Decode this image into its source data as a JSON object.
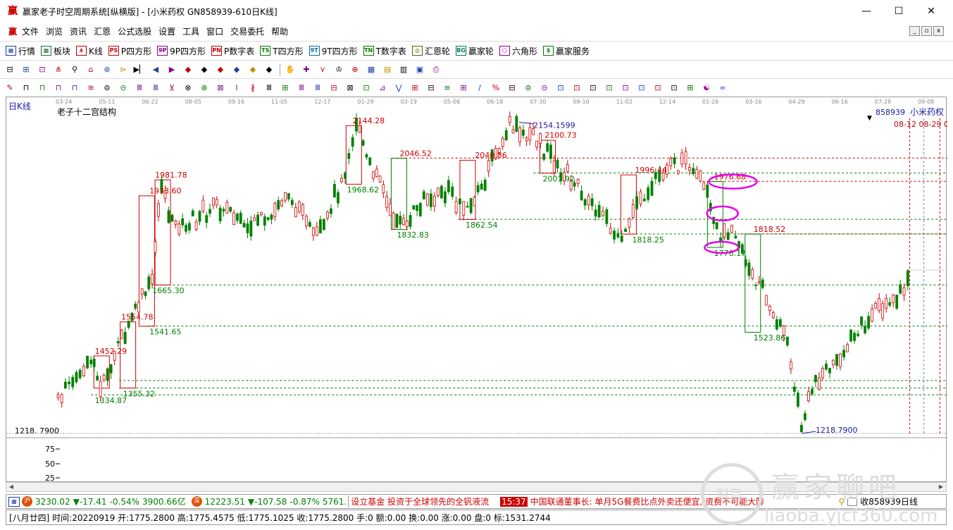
{
  "window": {
    "title": "赢家老子时空周期系统[纵横版] - [小米药权  GN858939-610日K线]",
    "logo": "赢",
    "minimize": "—",
    "maximize": "☐",
    "close": "✕"
  },
  "menu": {
    "logo": "赢",
    "items": [
      "文件",
      "浏览",
      "资讯",
      "汇恩",
      "公式选股",
      "设置",
      "工具",
      "窗口",
      "交易委托",
      "帮助"
    ]
  },
  "toolbar1": [
    {
      "label": "行情",
      "icon": "grid-icon",
      "glyph": "▦",
      "color": "#1f3fa8"
    },
    {
      "label": "板块",
      "icon": "blocks-icon",
      "glyph": "▩",
      "color": "#1f6f3f"
    },
    {
      "label": "K线",
      "icon": "candle-icon",
      "glyph": "⋔",
      "color": "#c00000"
    },
    {
      "label": "P四方形",
      "icon": "ps-icon",
      "glyph": "PS",
      "color": "#c00000"
    },
    {
      "label": "9P四方形",
      "icon": "9p-icon",
      "glyph": "9P",
      "color": "#8a008a"
    },
    {
      "label": "P数字表",
      "icon": "pn-icon",
      "glyph": "PN",
      "color": "#c00000"
    },
    {
      "label": "T四方形",
      "icon": "ts-icon",
      "glyph": "TS",
      "color": "#007a00"
    },
    {
      "label": "9T四方形",
      "icon": "9t-icon",
      "glyph": "9T",
      "color": "#00709a"
    },
    {
      "label": "T数字表",
      "icon": "tn-icon",
      "glyph": "TN",
      "color": "#007a00"
    },
    {
      "label": "汇恩轮",
      "icon": "wheel-icon",
      "glyph": "◎",
      "color": "#4a6a00"
    },
    {
      "label": "赢家轮",
      "icon": "bg-wheel-icon",
      "glyph": "BG",
      "color": "#007a5a"
    },
    {
      "label": "六角形",
      "icon": "hexagon-icon",
      "glyph": "⬡",
      "color": "#8a008a"
    },
    {
      "label": "赢家服务",
      "icon": "dollar-icon",
      "glyph": "$",
      "color": "#007a00"
    }
  ],
  "chart": {
    "period_label": "日K线",
    "indicator_label": "老子十二宫结构",
    "code": "858939",
    "name": "小米药权",
    "date_marks": "08-12  08-29  09-09",
    "axis_dates": [
      "03-24",
      "05-11",
      "06-22",
      "08-05",
      "09-16",
      "11-05",
      "12-17",
      "01-29",
      "03-19",
      "05-06",
      "06-18",
      "07-30",
      "09-10",
      "11-02",
      "12-14",
      "01-26",
      "03-16",
      "04-29",
      "06-16",
      "07-28",
      "09-08"
    ],
    "y_min_label": "1218. 7900",
    "volume_ticks": [
      "75",
      "50",
      "25"
    ]
  },
  "chart_data": {
    "type": "candlestick",
    "annotations_red": [
      {
        "label": "2144.28",
        "x": 0.368,
        "y": 2144.28
      },
      {
        "label": "2046.52",
        "x": 0.418,
        "y": 2046.52
      },
      {
        "label": "2040.86",
        "x": 0.498,
        "y": 2040.86
      },
      {
        "label": "2100.73",
        "x": 0.572,
        "y": 2100.73
      },
      {
        "label": "1996.44",
        "x": 0.668,
        "y": 1996.44
      },
      {
        "label": "1976.68",
        "x": 0.752,
        "y": 1976.68
      },
      {
        "label": "1818.52",
        "x": 0.794,
        "y": 1818.52
      },
      {
        "label": "1981.78",
        "x": 0.158,
        "y": 1981.78
      },
      {
        "label": "1933.60",
        "x": 0.152,
        "y": 1933.6
      },
      {
        "label": "1554.78",
        "x": 0.122,
        "y": 1554.78
      },
      {
        "label": "1452.29",
        "x": 0.094,
        "y": 1452.29
      }
    ],
    "annotations_green": [
      {
        "label": "1968.62",
        "x": 0.362,
        "y": 1968.62
      },
      {
        "label": "1832.83",
        "x": 0.415,
        "y": 1832.83
      },
      {
        "label": "1862.54",
        "x": 0.488,
        "y": 1862.54
      },
      {
        "label": "2001.92",
        "x": 0.57,
        "y": 2001.92
      },
      {
        "label": "1818.25",
        "x": 0.665,
        "y": 1818.25
      },
      {
        "label": "1778.17",
        "x": 0.752,
        "y": 1778.17
      },
      {
        "label": "1523.86",
        "x": 0.794,
        "y": 1523.86
      },
      {
        "label": "1665.30",
        "x": 0.155,
        "y": 1665.3
      },
      {
        "label": "1541.65",
        "x": 0.152,
        "y": 1541.65
      },
      {
        "label": "1355.32",
        "x": 0.124,
        "y": 1355.32
      },
      {
        "label": "1334.87",
        "x": 0.094,
        "y": 1334.87
      }
    ],
    "annotations_blue": [
      {
        "label": "2154.1599",
        "x": 0.56,
        "y": 2154.16
      },
      {
        "label": "1218.7900",
        "x": 0.86,
        "y": 1218.79
      }
    ],
    "ylim": [
      1218.79,
      2170
    ]
  },
  "ticker": {
    "idx1_value": "3230.02",
    "idx1_change": "▼-17.41",
    "idx1_pct": "-0.54%",
    "idx1_amt": "3900.66亿",
    "idx2_value": "12223.51",
    "idx2_change": "▼-107.58",
    "idx2_pct": "-0.87%",
    "idx2_amt": "5761.",
    "news1": "设立基金 投资于全球领先的全钒液流",
    "time": "15:37",
    "news2": "中国联通董事长: 单月5G餐费比点外卖还便宜, 资费不可能大降",
    "right": "收858939日线"
  },
  "status": {
    "text": "[八月廿四] 时间:20220919 开:1775.2800 高:1775.4575 低:1775.1025 收:1775.2800 手:0 额:0.00 换:0.00 涨:0.00 盘:0 标:1531.2744"
  },
  "watermark": {
    "big": "赢家聊吧",
    "small": "liaoba.yjcf360.com",
    "seal": "财富"
  },
  "colors": {
    "up": "#d00000",
    "down": "#008000",
    "blue": "#1a1aa0",
    "magenta": "#e600e6"
  }
}
